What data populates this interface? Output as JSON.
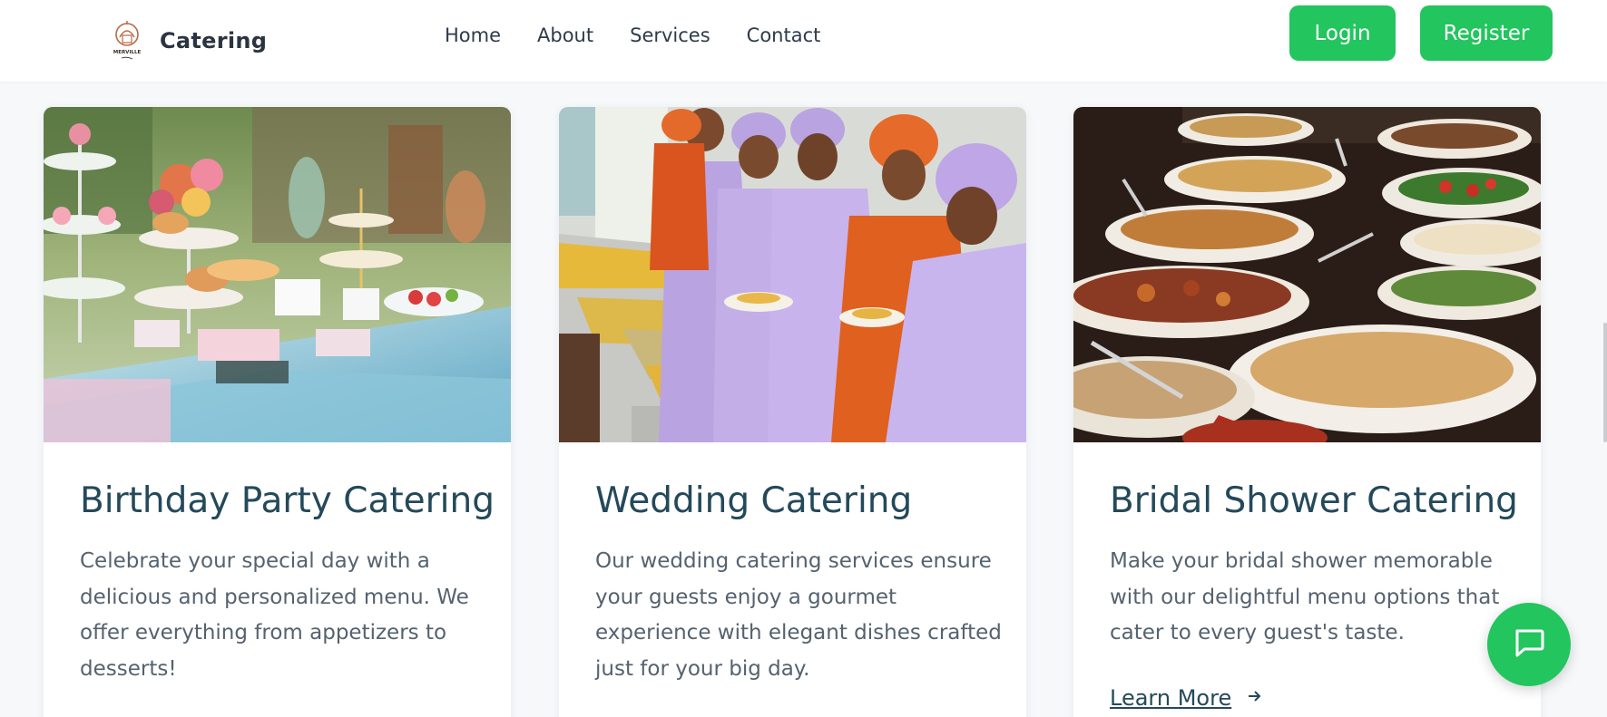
{
  "header": {
    "brand": "Catering",
    "logo_text": "MERVILLE",
    "nav": [
      "Home",
      "About",
      "Services",
      "Contact"
    ],
    "login_label": "Login",
    "register_label": "Register"
  },
  "cards": [
    {
      "title": "Birthday Party Catering",
      "description": "Celebrate your special day with a delicious and personalized menu. We offer everything from appetizers to desserts!",
      "image": "birthday-dessert-table-photo"
    },
    {
      "title": "Wedding Catering",
      "description": "Our wedding catering services ensure your guests enjoy a gourmet experience with elegant dishes crafted just for your big day.",
      "image": "wedding-buffet-guests-photo"
    },
    {
      "title": "Bridal Shower Catering",
      "description": "Make your bridal shower memorable with our delightful menu options that cater to every guest's taste.",
      "image": "buffet-bowls-photo",
      "link": "Learn More",
      "link_icon": "arrow-right-icon"
    }
  ],
  "chat": {
    "icon": "chat-bubble-icon"
  },
  "colors": {
    "accent": "#22c55e",
    "title": "#24495a",
    "body_text": "#55626f",
    "background": "#f6f8fa"
  }
}
